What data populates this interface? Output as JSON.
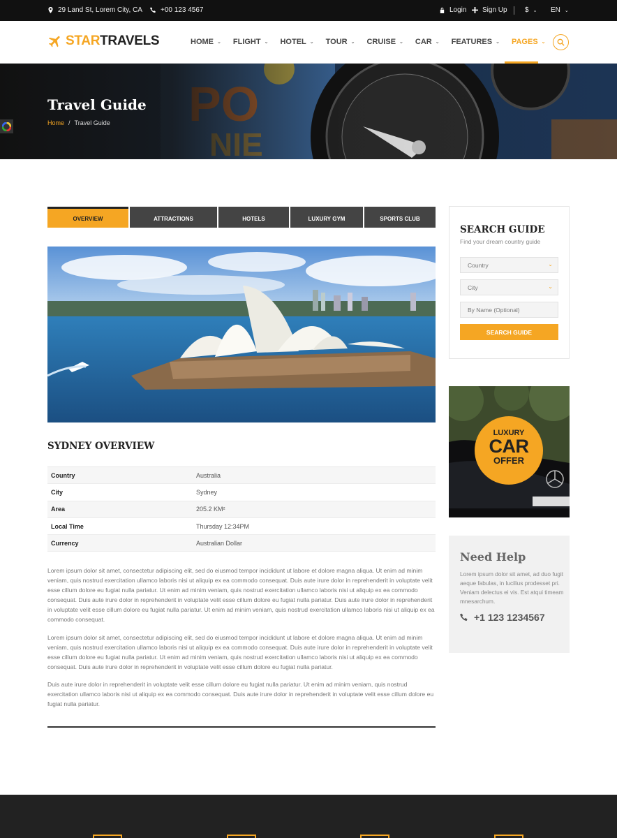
{
  "topbar": {
    "address": "29 Land St, Lorem City, CA",
    "phone": "+00 123 4567",
    "login": "Login",
    "signup": "Sign Up",
    "currency": "$",
    "language": "EN"
  },
  "header": {
    "logo_star": "STAR",
    "logo_travels": "TRAVELS",
    "nav": [
      {
        "label": "HOME"
      },
      {
        "label": "FLIGHT"
      },
      {
        "label": "HOTEL"
      },
      {
        "label": "TOUR"
      },
      {
        "label": "CRUISE"
      },
      {
        "label": "CAR"
      },
      {
        "label": "FEATURES"
      },
      {
        "label": "PAGES"
      }
    ],
    "accent": "#f5a623"
  },
  "hero": {
    "title": "Travel Guide",
    "breadcrumb_home": "Home",
    "breadcrumb_sep": "/",
    "breadcrumb_current": "Travel Guide"
  },
  "tabs": [
    "OVERVIEW",
    "ATTRACTIONS",
    "HOTELS",
    "LUXURY GYM",
    "SPORTS CLUB"
  ],
  "overview": {
    "title": "SYDNEY OVERVIEW",
    "rows": [
      {
        "k": "Country",
        "v": "Australia"
      },
      {
        "k": "City",
        "v": "Sydney"
      },
      {
        "k": "Area",
        "v": "205.2 KM²"
      },
      {
        "k": "Local Time",
        "v": "Thursday 12:34PM"
      },
      {
        "k": "Currency",
        "v": "Australian Dollar"
      }
    ],
    "paragraphs": [
      "Lorem ipsum dolor sit amet, consectetur adipiscing elit, sed do eiusmod tempor incididunt ut labore et dolore magna aliqua. Ut enim ad minim veniam, quis nostrud exercitation ullamco laboris nisi ut aliquip ex ea commodo consequat. Duis aute irure dolor in reprehenderit in voluptate velit esse cillum dolore eu fugiat nulla pariatur. Ut enim ad minim veniam, quis nostrud exercitation ullamco laboris nisi ut aliquip ex ea commodo consequat. Duis aute irure dolor in reprehenderit in voluptate velit esse cillum dolore eu fugiat nulla pariatur. Duis aute irure dolor in reprehenderit in voluptate velit esse cillum dolore eu fugiat nulla pariatur. Ut enim ad minim veniam, quis nostrud exercitation ullamco laboris nisi ut aliquip ex ea commodo consequat.",
      "Lorem ipsum dolor sit amet, consectetur adipiscing elit, sed do eiusmod tempor incididunt ut labore et dolore magna aliqua. Ut enim ad minim veniam, quis nostrud exercitation ullamco laboris nisi ut aliquip ex ea commodo consequat. Duis aute irure dolor in reprehenderit in voluptate velit esse cillum dolore eu fugiat nulla pariatur. Ut enim ad minim veniam, quis nostrud exercitation ullamco laboris nisi ut aliquip ex ea commodo consequat. Duis aute irure dolor in reprehenderit in voluptate velit esse cillum dolore eu fugiat nulla pariatur.",
      "Duis aute irure dolor in reprehenderit in voluptate velit esse cillum dolore eu fugiat nulla pariatur. Ut enim ad minim veniam, quis nostrud exercitation ullamco laboris nisi ut aliquip ex ea commodo consequat. Duis aute irure dolor in reprehenderit in voluptate velit esse cillum dolore eu fugiat nulla pariatur."
    ]
  },
  "search_guide": {
    "title": "SEARCH GUIDE",
    "subtitle": "Find your dream country guide",
    "country": "Country",
    "city": "City",
    "name_placeholder": "By Name (Optional)",
    "button": "SEARCH GUIDE"
  },
  "ad": {
    "line1": "LUXURY",
    "line2": "CAR",
    "line3": "OFFER"
  },
  "help": {
    "title": "Need Help",
    "text": "Lorem ipsum dolor sit amet, ad duo fugit aeque fabulas, in lucilius prodesset pri. Veniam delectus ei vis. Est atqui timeam mnesarchum.",
    "phone": "+1 123 1234567"
  }
}
